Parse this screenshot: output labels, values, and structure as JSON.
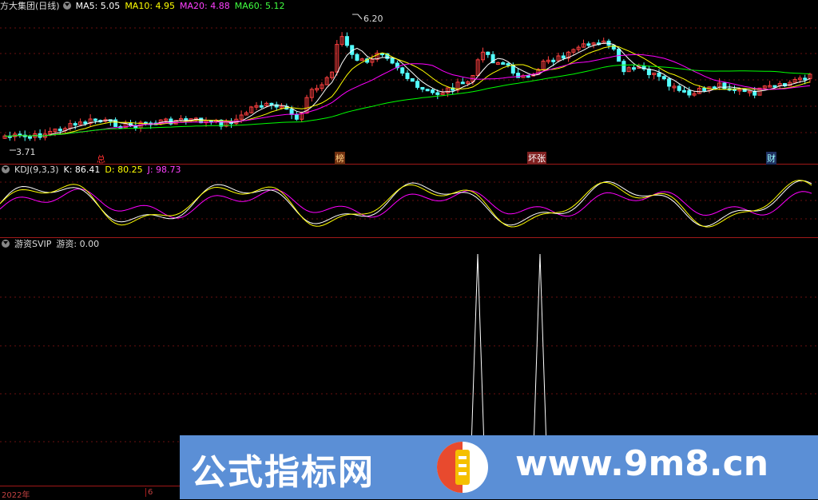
{
  "main_header": {
    "stock": "方大集团(日线)",
    "ma5": "MA5: 5.05",
    "ma10": "MA10: 4.95",
    "ma20": "MA20: 4.88",
    "ma60": "MA60: 5.12"
  },
  "kdj_header": {
    "name": "KDJ(9,3,3)",
    "k": "K: 86.41",
    "d": "D: 80.25",
    "j": "J: 98.73"
  },
  "yz_header": {
    "name": "游资SVIP",
    "value": "游资: 0.00"
  },
  "price_labels": {
    "high": "6.20",
    "low": "3.71"
  },
  "event_marks": [
    {
      "text": "总"
    },
    {
      "text": "榜"
    },
    {
      "text": "坏张"
    },
    {
      "text": "财"
    }
  ],
  "axis": {
    "year": "2022年",
    "month": "6"
  },
  "watermark": {
    "left": "公式指标网",
    "right": "www.9m8.cn"
  },
  "colors": {
    "ma5": "#ffffff",
    "ma10": "#ffff00",
    "ma20": "#ff00ff",
    "ma60": "#00ff00",
    "up": "#ff4040",
    "down": "#54ffff",
    "k": "#ffffff",
    "d": "#ffff00",
    "j": "#ff00ff",
    "separator": "#a01818",
    "watermark_bg": "#5b8fd6"
  }
}
